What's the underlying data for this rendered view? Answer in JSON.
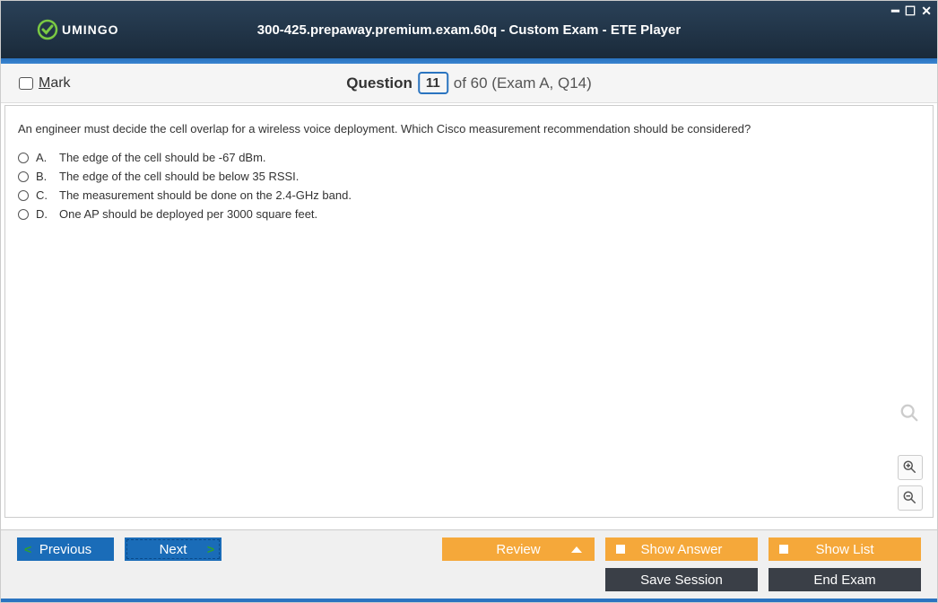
{
  "logo": {
    "text": "UMINGO"
  },
  "title": "300-425.prepaway.premium.exam.60q - Custom Exam - ETE Player",
  "mark": {
    "prefix": "M",
    "rest": "ark"
  },
  "question_header": {
    "label": "Question",
    "number": "11",
    "suffix": "of 60 (Exam A, Q14)"
  },
  "question": {
    "text": "An engineer must decide the cell overlap for a wireless voice deployment. Which Cisco measurement recommendation should be considered?",
    "answers": [
      {
        "letter": "A.",
        "text": "The edge of the cell should be -67 dBm."
      },
      {
        "letter": "B.",
        "text": "The edge of the cell should be below 35 RSSI."
      },
      {
        "letter": "C.",
        "text": "The measurement should be done on the 2.4-GHz band."
      },
      {
        "letter": "D.",
        "text": "One AP should be deployed per 3000 square feet."
      }
    ]
  },
  "buttons": {
    "previous": "Previous",
    "next": "Next",
    "review": "Review",
    "show_answer": "Show Answer",
    "show_list": "Show List",
    "save_session": "Save Session",
    "end_exam": "End Exam"
  }
}
